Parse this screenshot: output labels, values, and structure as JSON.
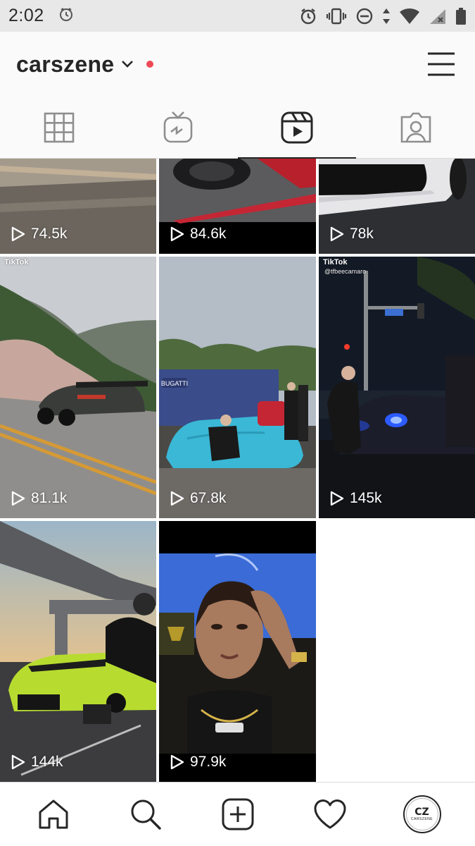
{
  "status_bar": {
    "time": "2:02",
    "icons": [
      "clock-outline-icon",
      "alarm-icon",
      "vibrate-icon",
      "do-not-disturb-icon",
      "data-arrows-icon",
      "wifi-icon",
      "signal-icon",
      "battery-icon"
    ]
  },
  "header": {
    "username": "carszene",
    "has_notification": true,
    "accent_color": "#ed4956"
  },
  "tabs": [
    {
      "name": "posts-grid",
      "icon": "grid-icon",
      "active": false
    },
    {
      "name": "igtv",
      "icon": "igtv-icon",
      "active": false
    },
    {
      "name": "reels",
      "icon": "reels-icon",
      "active": true
    },
    {
      "name": "tagged",
      "icon": "tagged-icon",
      "active": false
    }
  ],
  "reels": [
    {
      "views": "74.5k",
      "scene": "road-motion-blur"
    },
    {
      "views": "84.6k",
      "scene": "car-wheel-closeup"
    },
    {
      "views": "78k",
      "scene": "white-car-bumper"
    },
    {
      "views": "81.1k",
      "scene": "black-supercar-mountain-road",
      "watermark": "TikTok"
    },
    {
      "views": "67.8k",
      "scene": "covered-car-reveal",
      "sign": "BUGATTI"
    },
    {
      "views": "145k",
      "scene": "night-blue-headlights",
      "watermark": "TikTok",
      "handle": "@tfbeecamaro"
    },
    {
      "views": "144k",
      "scene": "lime-camaro-under-bridge"
    },
    {
      "views": "97.9k",
      "scene": "woman-in-lamborghini"
    }
  ],
  "bottom_nav": {
    "items": [
      "home-icon",
      "search-icon",
      "new-post-icon",
      "activity-heart-icon",
      "profile-avatar"
    ],
    "avatar_label": "CARSZENE"
  }
}
